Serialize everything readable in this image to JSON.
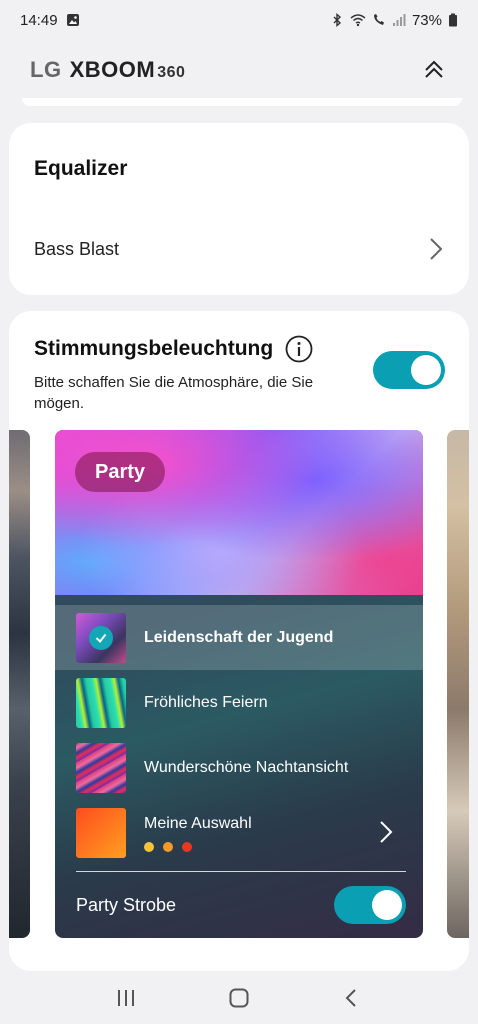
{
  "status_bar": {
    "time": "14:49",
    "battery": "73%",
    "icons": [
      "gallery-icon",
      "bluetooth-icon",
      "wifi-icon",
      "call-icon",
      "signal-icon",
      "battery-icon"
    ]
  },
  "header": {
    "brand": "LG",
    "model": "XBOOM",
    "model_number": "360",
    "collapse_icon": "double-chevron-up-icon"
  },
  "equalizer": {
    "title": "Equalizer",
    "value": "Bass Blast"
  },
  "mood_lighting": {
    "title": "Stimmungsbeleuchtung",
    "description": "Bitte schaffen Sie die Atmosphäre, die Sie mögen.",
    "enabled": true,
    "accent_color": "#0a9fb2",
    "theme": {
      "badge": "Party",
      "items": [
        {
          "label": "Leidenschaft der Jugend",
          "selected": true
        },
        {
          "label": "Fröhliches Feiern",
          "selected": false
        },
        {
          "label": "Wunderschöne Nachtansicht",
          "selected": false
        },
        {
          "label": "Meine Auswahl",
          "selected": false,
          "dot_colors": [
            "#f5c43a",
            "#f49a2a",
            "#e8391f"
          ]
        }
      ],
      "strobe_label": "Party Strobe",
      "strobe_enabled": true
    }
  },
  "nav": {
    "icons": [
      "recent-apps-icon",
      "home-icon",
      "back-icon"
    ]
  }
}
